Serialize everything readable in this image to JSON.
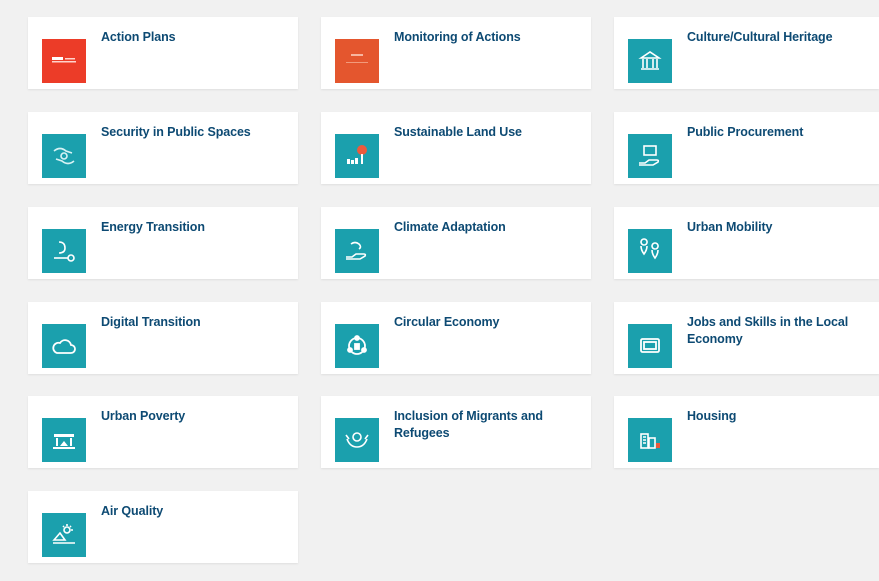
{
  "cards": [
    {
      "label": "Action Plans",
      "icon": "action-plans-logo-icon",
      "tile_color": "#ec3c28"
    },
    {
      "label": "Monitoring of Actions",
      "icon": "monitoring-document-icon",
      "tile_color": "#e4562e"
    },
    {
      "label": "Culture/Cultural Heritage",
      "icon": "museum-building-icon",
      "tile_color": "#1ba0ad"
    },
    {
      "label": "Security in Public Spaces",
      "icon": "security-hands-icon",
      "tile_color": "#1ba0ad"
    },
    {
      "label": "Sustainable Land Use",
      "icon": "land-use-tree-icon",
      "tile_color": "#1ba0ad"
    },
    {
      "label": "Public Procurement",
      "icon": "procurement-hand-icon",
      "tile_color": "#1ba0ad"
    },
    {
      "label": "Energy Transition",
      "icon": "energy-plug-icon",
      "tile_color": "#1ba0ad"
    },
    {
      "label": "Climate Adaptation",
      "icon": "climate-hand-icon",
      "tile_color": "#1ba0ad"
    },
    {
      "label": "Urban Mobility",
      "icon": "map-pins-icon",
      "tile_color": "#1ba0ad"
    },
    {
      "label": "Digital Transition",
      "icon": "cloud-icon",
      "tile_color": "#1ba0ad"
    },
    {
      "label": "Circular Economy",
      "icon": "circular-arrows-icon",
      "tile_color": "#1ba0ad"
    },
    {
      "label": "Jobs and Skills in the Local Economy",
      "icon": "monitor-icon",
      "tile_color": "#1ba0ad"
    },
    {
      "label": "Urban Poverty",
      "icon": "shelter-icon",
      "tile_color": "#1ba0ad"
    },
    {
      "label": "Inclusion of Migrants and Refugees",
      "icon": "inclusion-hands-icon",
      "tile_color": "#1ba0ad"
    },
    {
      "label": "Housing",
      "icon": "housing-buildings-icon",
      "tile_color": "#1ba0ad"
    },
    {
      "label": "Air Quality",
      "icon": "air-quality-sun-icon",
      "tile_color": "#1ba0ad"
    }
  ]
}
